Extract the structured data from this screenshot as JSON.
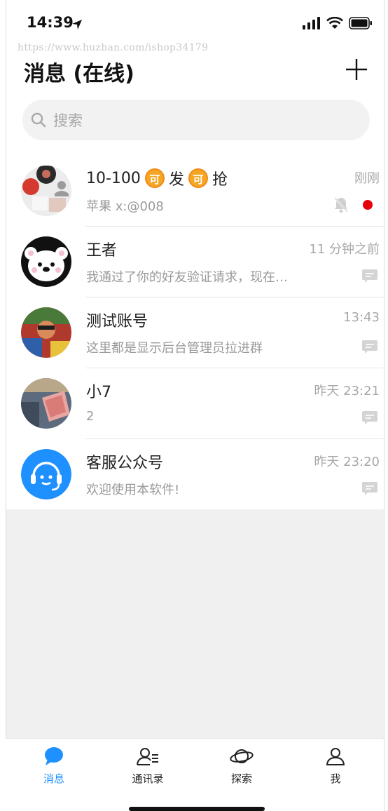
{
  "status_bar": {
    "time": "14:39"
  },
  "watermark": "https://www.huzhan.com/ishop34179",
  "header": {
    "title": "消息 (在线)"
  },
  "search": {
    "placeholder": "搜索"
  },
  "chats": [
    {
      "name_parts": [
        "10-100",
        "发",
        "抢"
      ],
      "badge_text": "可",
      "preview": "苹果 x:@008",
      "time": "刚刚",
      "muted": true,
      "unread_dot": true
    },
    {
      "name": "王者",
      "preview": "我通过了你的好友验证请求，现在…",
      "time": "11 分钟之前"
    },
    {
      "name": "测试账号",
      "preview": "这里都是显示后台管理员拉进群",
      "time": "13:43"
    },
    {
      "name": "小7",
      "preview": "2",
      "time": "昨天 23:21"
    },
    {
      "name": "客服公众号",
      "preview": "欢迎使用本软件!",
      "time": "昨天 23:20"
    }
  ],
  "tabs": [
    {
      "label": "消息",
      "icon": "chat-bubble-icon",
      "active": true
    },
    {
      "label": "通讯录",
      "icon": "contacts-icon"
    },
    {
      "label": "探索",
      "icon": "planet-icon"
    },
    {
      "label": "我",
      "icon": "person-icon"
    }
  ],
  "colors": {
    "accent": "#1e90ff",
    "unread_dot": "#e6000a",
    "badge": "#f5a623",
    "service_avatar": "#1e90ff"
  }
}
